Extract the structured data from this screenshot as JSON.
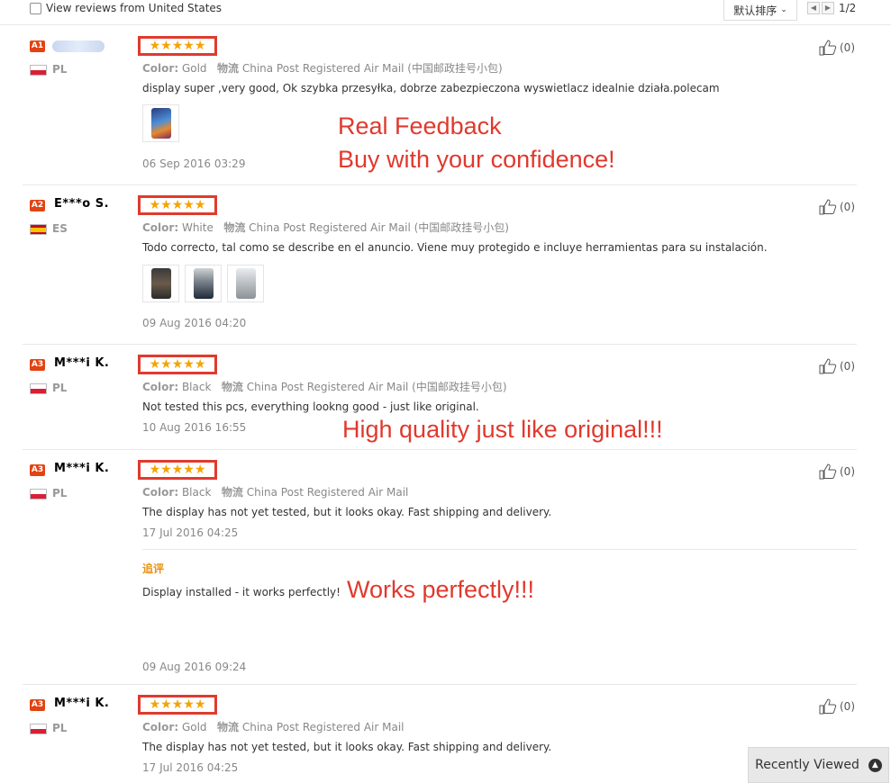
{
  "top": {
    "filter_label": "View reviews from United States",
    "sort_label": "默认排序",
    "page_indicator": "1/2"
  },
  "reviews": [
    {
      "badge": "A1",
      "name": "",
      "country": "PL",
      "flag": "pl",
      "stars": 5,
      "color_label": "Color:",
      "color_value": "Gold",
      "ship_label": "物流",
      "ship_value": "China Post Registered Air Mail (中国邮政挂号小包)",
      "text": "display super ,very good, Ok szybka przesyłka, dobrze zabezpieczona wyswietlacz idealnie działa.polecam",
      "date": "06 Sep 2016 03:29",
      "likes": "(0)"
    },
    {
      "badge": "A2",
      "name": "E***o S.",
      "country": "ES",
      "flag": "es",
      "stars": 5,
      "color_label": "Color:",
      "color_value": "White",
      "ship_label": "物流",
      "ship_value": "China Post Registered Air Mail (中国邮政挂号小包)",
      "text": "Todo correcto, tal como se describe en el anuncio. Viene muy protegido e incluye herramientas para su instalación.",
      "date": "09 Aug 2016 04:20",
      "likes": "(0)"
    },
    {
      "badge": "A3",
      "name": "M***i K.",
      "country": "PL",
      "flag": "pl",
      "stars": 5,
      "color_label": "Color:",
      "color_value": "Black",
      "ship_label": "物流",
      "ship_value": "China Post Registered Air Mail (中国邮政挂号小包)",
      "text": "Not tested this pcs, everything lookng good - just like original.",
      "date": "10 Aug 2016 16:55",
      "likes": "(0)"
    },
    {
      "badge": "A3",
      "name": "M***i K.",
      "country": "PL",
      "flag": "pl",
      "stars": 5,
      "color_label": "Color:",
      "color_value": "Black",
      "ship_label": "物流",
      "ship_value": "China Post Registered Air Mail",
      "text": "The display has not yet tested, but it looks okay. Fast shipping and delivery.",
      "date": "17 Jul 2016 04:25",
      "likes": "(0)",
      "followup_title": "追评",
      "followup_text": "Display installed - it works perfectly!",
      "followup_date": "09 Aug 2016 09:24"
    },
    {
      "badge": "A3",
      "name": "M***i K.",
      "country": "PL",
      "flag": "pl",
      "stars": 5,
      "color_label": "Color:",
      "color_value": "Gold",
      "ship_label": "物流",
      "ship_value": "China Post Registered Air Mail",
      "text": "The display has not yet tested, but it looks okay. Fast shipping and delivery.",
      "date": "17 Jul 2016 04:25",
      "likes": "(0)"
    }
  ],
  "annotations": {
    "a1": "Real Feedback",
    "a2": "Buy with your confidence!",
    "a3": "High quality just like original!!!",
    "a4": "Works perfectly!!!"
  },
  "recent": {
    "label": "Recently Viewed"
  },
  "colors": {
    "accent_red": "#e03a2e",
    "star": "#f5a300",
    "badge": "#e24312",
    "followup": "#e8910f"
  }
}
